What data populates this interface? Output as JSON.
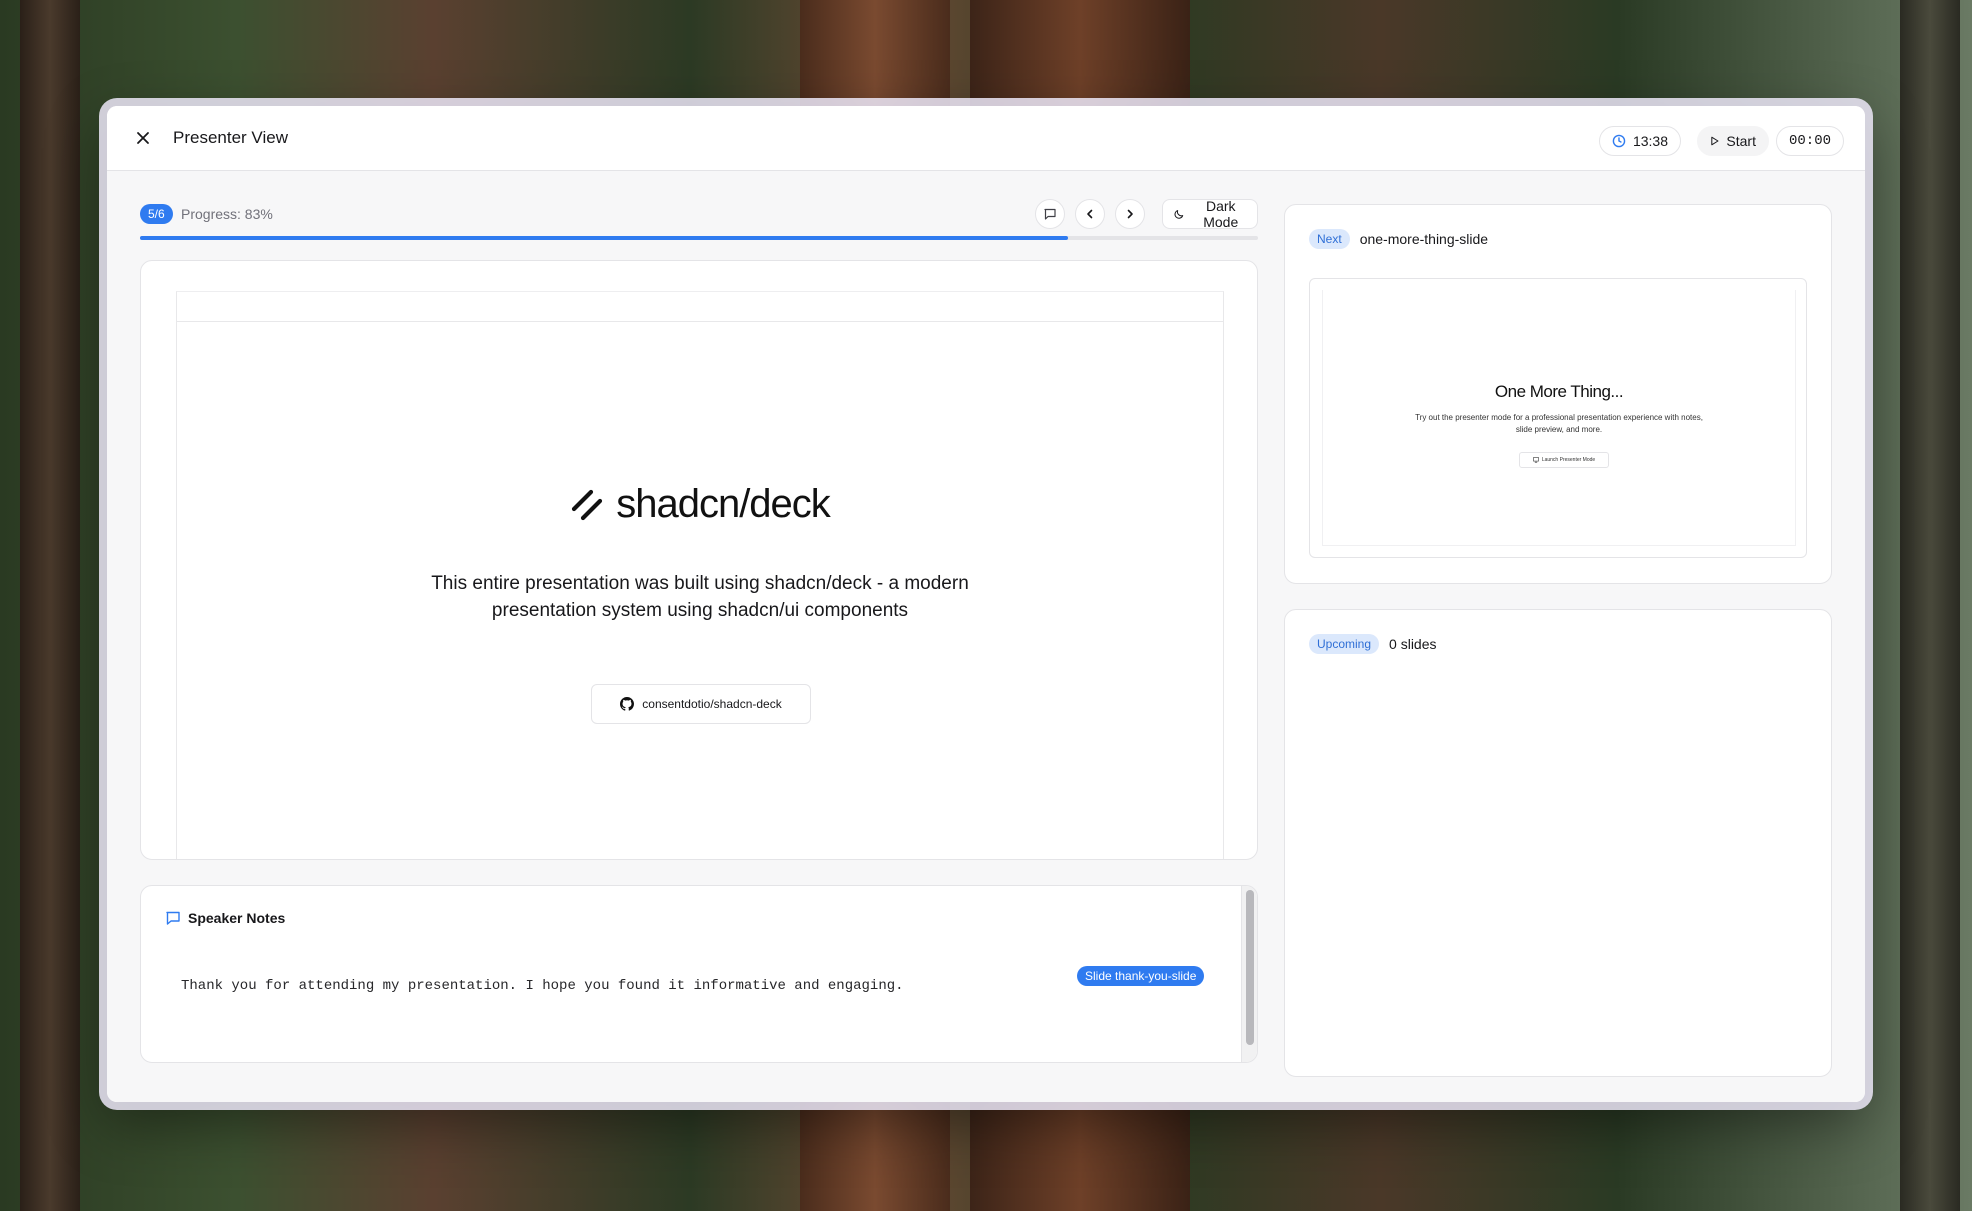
{
  "header": {
    "title": "Presenter View",
    "clock": "13:38",
    "start_label": "Start",
    "timer": "00:00"
  },
  "progress": {
    "slide_badge": "5/6",
    "label": "Progress: 83%",
    "fraction": 0.83,
    "dark_mode_label": "Dark Mode"
  },
  "current_slide": {
    "brand": "shadcn/deck",
    "subtitle": "This entire presentation was built using shadcn/deck - a modern presentation system using shadcn/ui components",
    "repo_label": "consentdotio/shadcn-deck"
  },
  "notes": {
    "title": "Speaker Notes",
    "text": "Thank you for attending my presentation. I hope you found it informative and engaging.",
    "slide_badge": "Slide thank-you-slide"
  },
  "next": {
    "badge": "Next",
    "slide_id": "one-more-thing-slide",
    "preview_title": "One More Thing...",
    "preview_subtitle": "Try out the presenter mode for a professional presentation experience with notes, slide preview, and more.",
    "preview_button": "Launch Presenter Mode"
  },
  "upcoming": {
    "badge": "Upcoming",
    "count_label": "0 slides"
  },
  "colors": {
    "accent": "#2f7bf0"
  }
}
